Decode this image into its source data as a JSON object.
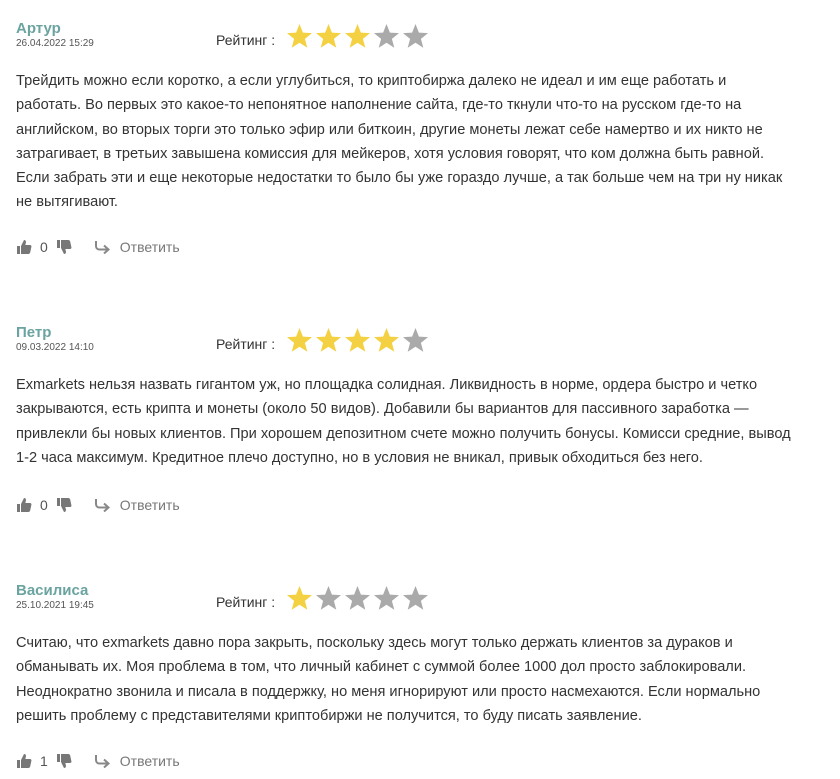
{
  "rating_label": "Рейтинг :",
  "reply_label": "Ответить",
  "colors": {
    "author": "#6aa39f",
    "star_on": "#f3d142",
    "star_off": "#aaaaaa"
  },
  "reviews": [
    {
      "author": "Артур",
      "date": "26.04.2022 15:29",
      "rating": 3,
      "likes": "0",
      "lines": [
        "Трейдить можно если коротко, а если углубиться, то криптобиржа далеко не идеал и им еще работать и",
        "работать. Во первых это какое-то непонятное наполнение сайта, где-то ткнули что-то на русском где-то на",
        "английском, во вторых торги это только эфир или биткоин, другие монеты лежат себе намертво и их никто не",
        "затрагивает, в третьих завышена комиссия для мейкеров, хотя условия говорят, что ком должна быть равной.",
        "Если забрать эти и еще некоторые недостатки то было бы уже гораздо лучше, а так больше чем на три ну никак",
        "не вытягивают."
      ]
    },
    {
      "author": "Петр",
      "date": "09.03.2022 14:10",
      "rating": 4,
      "likes": "0",
      "lines": [
        "Exmarkets нельзя назвать гигантом уж, но площадка солидная. Ликвидность в норме, ордера быстро и четко",
        "закрываются, есть крипта и монеты (около 50 видов). Добавили бы вариантов для пассивного заработка —",
        "привлекли бы новых клиентов. При хорошем депозитном счете можно получить бонусы. Комисси средние, вывод",
        "1-2 часа максимум. Кредитное плечо доступно, но в условия не вникал, привык обходиться без него."
      ]
    },
    {
      "author": "Василиса",
      "date": "25.10.2021 19:45",
      "rating": 1,
      "likes": "1",
      "lines": [
        "Считаю, что exmarkets давно пора закрыть, поскольку здесь могут только держать клиентов за дураков и",
        "обманывать их. Моя проблема в том, что личный кабинет с суммой более 1000 дол просто заблокировали.",
        "Неоднократно звонила и писала в поддержку, но меня игнорируют или просто насмехаются. Если нормально",
        "решить проблему с представителями криптобиржи не получится, то буду писать заявление."
      ]
    }
  ]
}
